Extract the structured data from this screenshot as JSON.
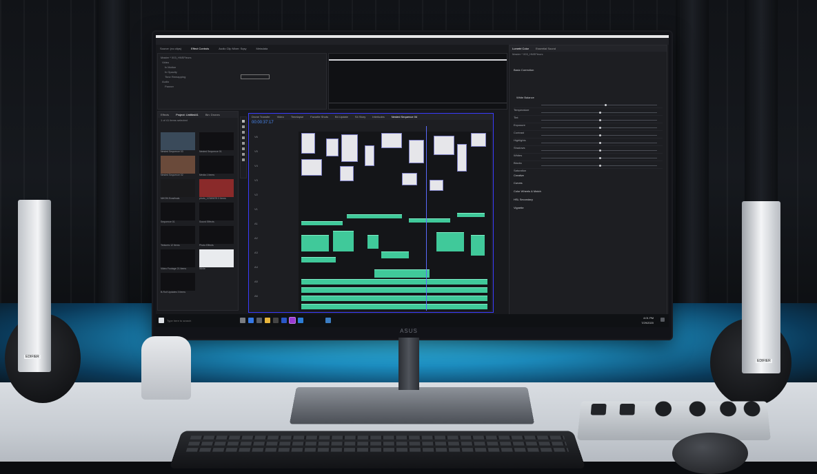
{
  "brand": {
    "monitor_logo": "ASUS",
    "speaker_badge": "EDIFIER"
  },
  "premiere": {
    "workspace_tabs": [
      "Source: (no clips)",
      "Effect Controls",
      "Audio Clip Mixer: Sqsy",
      "Metadata"
    ],
    "active_workspace_tab": "Effect Controls",
    "effect_controls": {
      "header": "Master * 003_HNSFleurs",
      "items": [
        "Video",
        "fx Motion",
        "fx Opacity",
        "Time Remapping",
        "Audio",
        "Panner"
      ]
    },
    "project_panel": {
      "tabs": [
        "Effects",
        "Project: Untitled41",
        "Bin: Drones"
      ],
      "search_label": "1 of 41 items selected",
      "items": [
        {
          "label": "Nested Sequence 03",
          "meta": ""
        },
        {
          "label": "Nested Sequence 01",
          "meta": ""
        },
        {
          "label": "Nested Sequence 02",
          "meta": ""
        },
        {
          "label": "Media",
          "meta": "1 Items"
        },
        {
          "label": "NIKON Erasfinals",
          "meta": ""
        },
        {
          "label": "photo_12345678",
          "meta": "3 Items"
        },
        {
          "label": "Sequence 01",
          "meta": ""
        },
        {
          "label": "Sound Effects",
          "meta": ""
        },
        {
          "label": "Textures",
          "meta": "12 Items"
        },
        {
          "label": "Photo Effects",
          "meta": ""
        },
        {
          "label": "Video Footage",
          "meta": "21 Items"
        },
        {
          "label": "White",
          "meta": ""
        },
        {
          "label": "B-Roll Updates",
          "meta": "3 Items"
        }
      ]
    },
    "timeline": {
      "tabs": [
        "Drone Transfer",
        "Video",
        "Timelapse",
        "Favorite Shots",
        "B4 Update",
        "S4 Story",
        "Interludes",
        "Nested Sequence 04"
      ],
      "timecode": "00:00:37:17",
      "ruler_labels": [
        "00:00",
        "00:00:15:00",
        "00:00:30:00",
        "00:00:45:00"
      ],
      "video_tracks": [
        "V6",
        "V5",
        "V4",
        "V3",
        "V2",
        "V1"
      ],
      "audio_tracks": [
        "A1",
        "A2",
        "A3",
        "A4",
        "A5",
        "A6"
      ]
    },
    "lumetri": {
      "tabs": [
        "Lumetri Color",
        "Essential Sound"
      ],
      "header": "Master * 003_HNSFleurs",
      "sections": [
        "Basic Correction",
        "White Balance",
        "Tone",
        "Creative",
        "Curves",
        "Color Wheels & Match",
        "HSL Secondary",
        "Vignette"
      ],
      "sliders": [
        {
          "label": "Temperature",
          "value": 0.55
        },
        {
          "label": "Tint",
          "value": 0.5
        },
        {
          "label": "Exposure",
          "value": 0.5
        },
        {
          "label": "Contrast",
          "value": 0.5
        },
        {
          "label": "Highlights",
          "value": 0.5
        },
        {
          "label": "Shadows",
          "value": 0.5
        },
        {
          "label": "Whites",
          "value": 0.5
        },
        {
          "label": "Blacks",
          "value": 0.5
        },
        {
          "label": "Saturation",
          "value": 0.5
        }
      ]
    },
    "taskbar": {
      "search_text": "Type here to search",
      "clock": "4:01 PM",
      "date": "7/29/2020"
    }
  },
  "colors": {
    "led": "#39c7f2",
    "timeline_border": "#3a3cff",
    "audio_clip": "#40c99a",
    "playhead": "#5b6bff"
  }
}
